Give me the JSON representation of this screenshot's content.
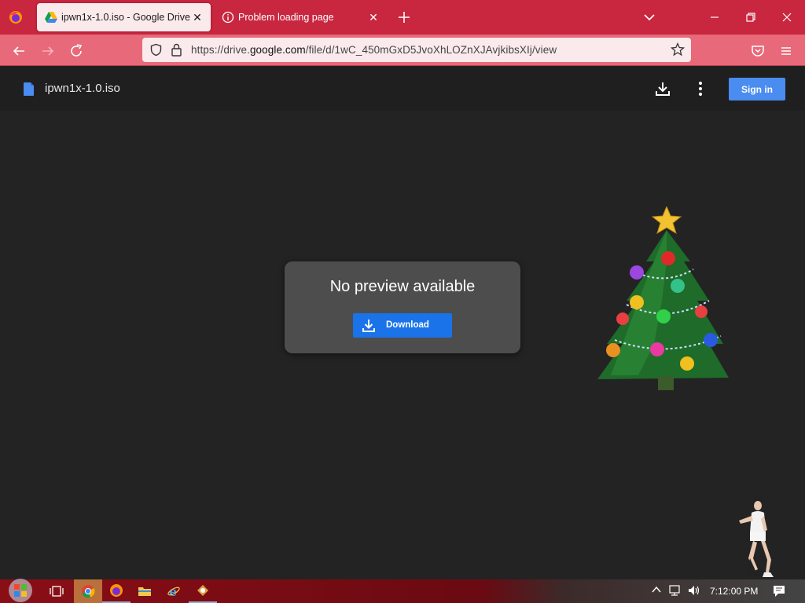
{
  "browser": {
    "tabs": [
      {
        "label": "ipwn1x-1.0.iso - Google Drive",
        "active": true,
        "icon": "google-drive-icon"
      },
      {
        "label": "Problem loading page",
        "active": false,
        "icon": "info-icon"
      }
    ],
    "url": {
      "prefix": "https://drive.",
      "host": "google.com",
      "path": "/file/d/1wC_450mGxD5JvoXhLOZnXJAvjkibsXIj/view"
    },
    "theme_colors": {
      "tabbar": "#c8273f",
      "navbar": "#e7697a",
      "urlbar": "#fbeaec"
    }
  },
  "drive": {
    "file_name": "ipwn1x-1.0.iso",
    "sign_in_label": "Sign in",
    "preview": {
      "title": "No preview available",
      "download_label": "Download"
    },
    "accent": "#1a73e8"
  },
  "taskbar": {
    "clock": "7:12:00 PM",
    "apps": [
      "task-view-icon",
      "chrome-icon",
      "firefox-icon",
      "file-explorer-icon",
      "internet-explorer-icon",
      "app-icon"
    ]
  }
}
